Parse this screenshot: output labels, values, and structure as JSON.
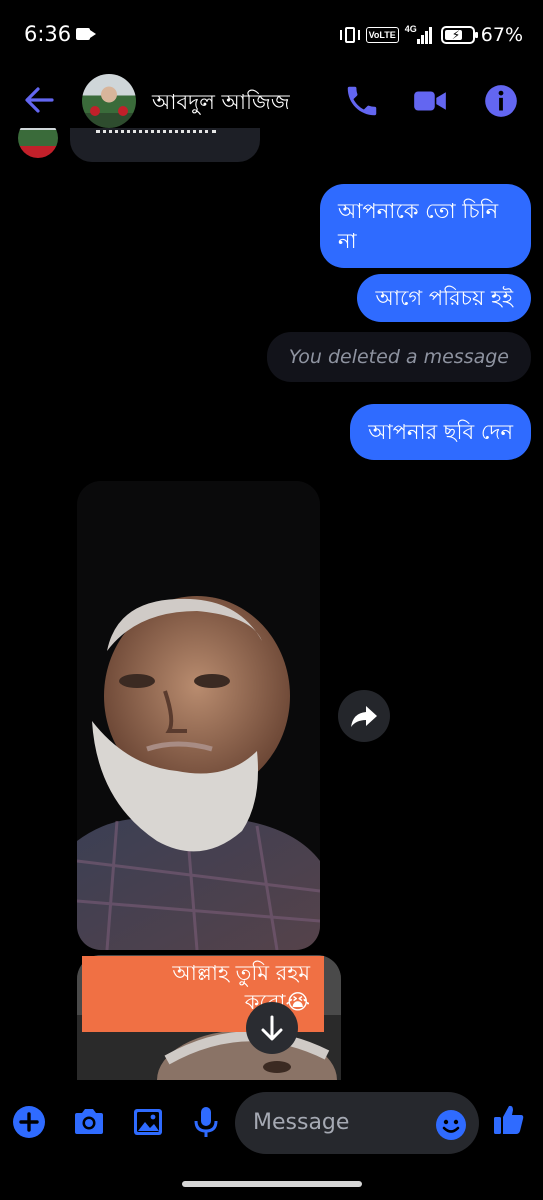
{
  "status_bar": {
    "time": "6:36",
    "volte": "VoLTE",
    "network": "4G",
    "battery_percent": "67%",
    "battery_level": 0.67
  },
  "header": {
    "contact_name": "আবদুল আজিজ"
  },
  "messages": {
    "sent": [
      "আপনাকে তো চিনি না",
      "আগে পরিচয় হই",
      "আপনার ছবি দেন"
    ],
    "deleted_notice": "You deleted a message",
    "image_caption": "আল্লাহ তুমি রহম করো😭"
  },
  "composer": {
    "placeholder": "Message"
  },
  "colors": {
    "accent": "#6366f1",
    "bubble_out": "#2f6bff",
    "background": "#000000",
    "caption_bg": "#f07044"
  },
  "icons": [
    "back-arrow-icon",
    "phone-icon",
    "video-camera-icon",
    "info-icon",
    "share-icon",
    "scroll-down-icon",
    "add-icon",
    "camera-icon",
    "gallery-icon",
    "microphone-icon",
    "emoji-icon",
    "thumbs-up-icon"
  ]
}
